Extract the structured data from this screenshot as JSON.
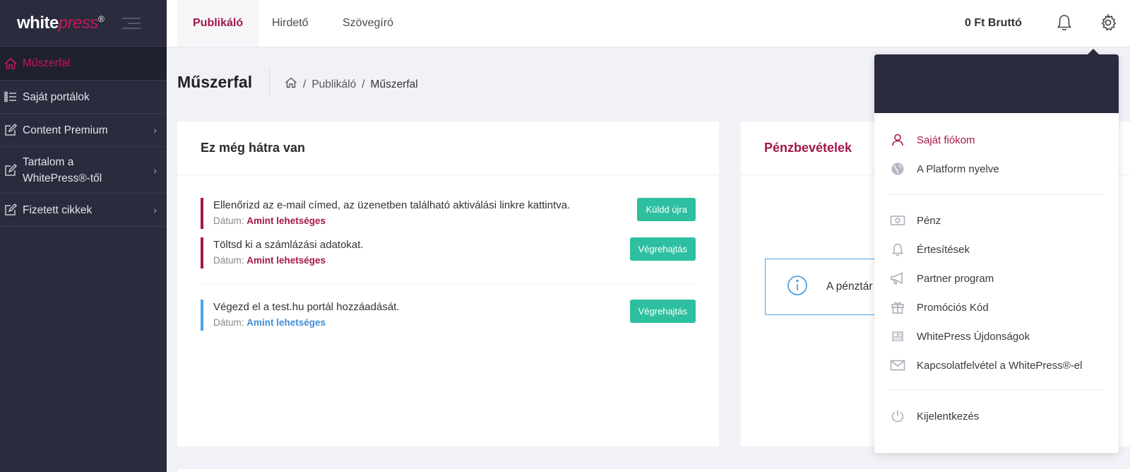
{
  "brand": {
    "main": "white",
    "accent": "press",
    "mark": "®"
  },
  "sidebar": {
    "items": [
      {
        "label": "Műszerfal",
        "icon": "home-icon",
        "active": true
      },
      {
        "label": "Saját portálok",
        "icon": "list-icon"
      },
      {
        "label": "Content Premium",
        "icon": "edit-icon"
      },
      {
        "label_line1": "Tartalom a",
        "label_line2": "WhitePress®-től",
        "icon": "edit-icon"
      },
      {
        "label": "Fizetett cikkek",
        "icon": "edit-icon"
      }
    ]
  },
  "topbar": {
    "tabs": [
      "Publikáló",
      "Hirdető",
      "Szövegíró"
    ],
    "balance": "0 Ft Bruttó"
  },
  "header": {
    "title": "Műszerfal",
    "breadcrumb": [
      "Publikáló",
      "Műszerfal"
    ]
  },
  "todo": {
    "title": "Ez még hátra van",
    "date_label": "Dátum:",
    "tasks": [
      {
        "text": "Ellenőrizd az e-mail címed, az üzenetben található aktiválási linkre kattintva.",
        "date": "Amint lehetséges",
        "button": "Küldd újra"
      },
      {
        "text": "Töltsd ki a számlázási adatokat.",
        "date": "Amint lehetséges",
        "button": "Végrehajtás"
      },
      {
        "text": "Végezd el a test.hu portál hozzáadását.",
        "date": "Amint lehetséges",
        "button": "Végrehajtás"
      }
    ]
  },
  "income": {
    "title": "Pénzbevételek",
    "info_text": "A pénztár"
  },
  "account_menu": {
    "items": [
      {
        "label": "Saját fiókom",
        "icon": "user-icon"
      },
      {
        "label": "A Platform nyelve",
        "icon": "globe-icon"
      },
      {
        "label": "Pénz",
        "icon": "money-icon"
      },
      {
        "label": "Értesítések",
        "icon": "bell-icon"
      },
      {
        "label": "Partner program",
        "icon": "megaphone-icon"
      },
      {
        "label": "Promóciós Kód",
        "icon": "gift-icon"
      },
      {
        "label": "WhitePress Újdonságok",
        "icon": "news-icon"
      },
      {
        "label": "Kapcsolatfelvétel a WhitePress®-el",
        "icon": "mail-icon"
      },
      {
        "label": "Kijelentkezés",
        "icon": "power-icon"
      }
    ]
  },
  "colors": {
    "sidebar": "#2a2b3d",
    "accent": "#a3174b",
    "button": "#2ebfa0",
    "info": "#4da3e8"
  }
}
